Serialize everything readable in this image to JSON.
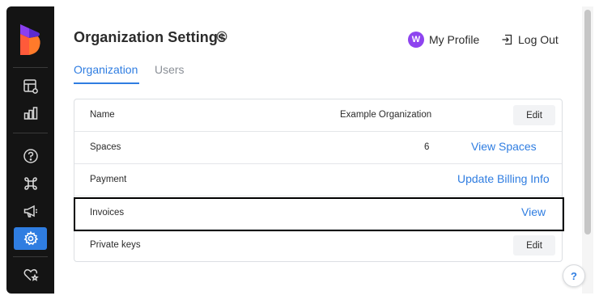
{
  "header": {
    "title": "Organization Settings",
    "profile_initial": "W",
    "profile_label": "My Profile",
    "logout_label": "Log Out"
  },
  "tabs": [
    {
      "label": "Organization",
      "active": true
    },
    {
      "label": "Users",
      "active": false
    }
  ],
  "rows": [
    {
      "label": "Name",
      "value": "Example Organization",
      "action": "Edit"
    },
    {
      "label": "Spaces",
      "value": "6",
      "action": "View Spaces"
    },
    {
      "label": "Payment",
      "value": "",
      "action": "Update Billing Info"
    },
    {
      "label": "Invoices",
      "value": "",
      "action": "View"
    },
    {
      "label": "Private keys",
      "value": "",
      "action": "Edit"
    }
  ],
  "sidebar": {
    "icons": [
      "table-settings-icon",
      "bar-chart-icon",
      "help-circle-icon",
      "command-icon",
      "megaphone-icon",
      "gear-icon",
      "heart-star-icon"
    ],
    "active": "gear-icon"
  },
  "help_fab": "?",
  "colors": {
    "accent": "#2f7de1",
    "avatar": "#8e44ef",
    "sidebar": "#141414"
  }
}
